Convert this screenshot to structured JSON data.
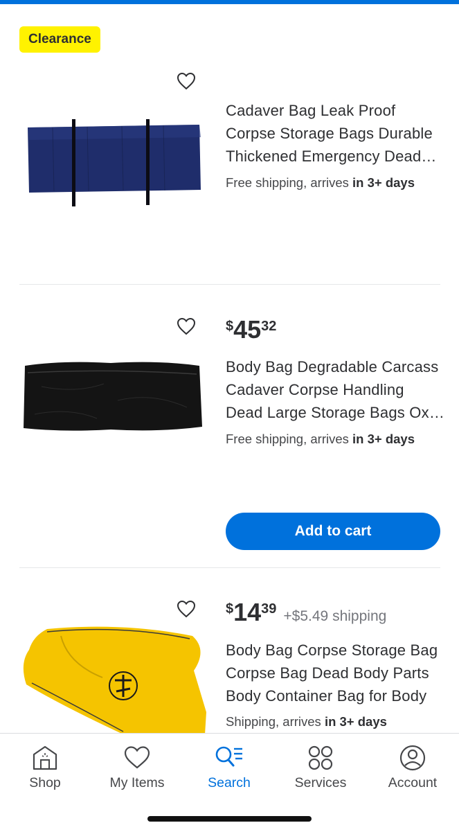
{
  "colors": {
    "accent": "#0071dc",
    "badge": "#fff200",
    "text": "#2e2f32"
  },
  "clearance_badge": "Clearance",
  "products": [
    {
      "title_lines": [
        "Cadaver Bag Leak Proof",
        "Corpse Storage Bags Durable",
        "Thickened Emergency Dead…"
      ],
      "shipping_prefix": "Free shipping, arrives ",
      "shipping_bold": "in 3+ days",
      "image": "navy-body-bag"
    },
    {
      "price_currency": "$",
      "price_dollars": "45",
      "price_cents": "32",
      "title_lines": [
        "Body Bag Degradable Carcass",
        "Cadaver Corpse Handling",
        "Dead Large Storage Bags Ox…"
      ],
      "shipping_prefix": "Free shipping, arrives ",
      "shipping_bold": "in 3+ days",
      "add_to_cart": "Add to cart",
      "image": "black-body-bag"
    },
    {
      "price_currency": "$",
      "price_dollars": "14",
      "price_cents": "39",
      "price_extra": "+$5.49 shipping",
      "title_lines": [
        "Body Bag Corpse Storage Bag",
        "Corpse Bag Dead Body Parts",
        "Body Container Bag for Body"
      ],
      "shipping_prefix": "Shipping, arrives ",
      "shipping_bold": "in 3+ days",
      "image": "yellow-body-bag"
    }
  ],
  "nav": {
    "items": [
      {
        "label": "Shop",
        "icon": "store-icon"
      },
      {
        "label": "My Items",
        "icon": "heart-icon"
      },
      {
        "label": "Search",
        "icon": "search-list-icon",
        "active": true
      },
      {
        "label": "Services",
        "icon": "services-icon"
      },
      {
        "label": "Account",
        "icon": "account-icon"
      }
    ]
  }
}
